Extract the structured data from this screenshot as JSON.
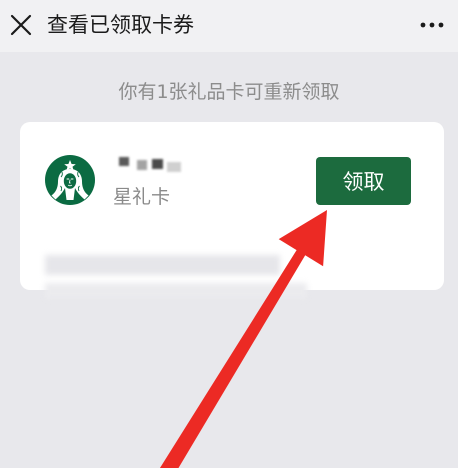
{
  "header": {
    "title": "查看已领取卡券",
    "close_icon": "close-icon",
    "more_icon": "more-icon"
  },
  "notice": "你有1张礼品卡可重新领取",
  "card": {
    "logo_icon": "starbucks-siren-logo",
    "card_name": "星礼卡",
    "claim_button": "领取"
  },
  "colors": {
    "header_bg": "#f1f1f3",
    "page_bg": "#e8e8ec",
    "card_bg": "#ffffff",
    "brand_green": "#1c6b3e",
    "notice_text": "#8c8c8c",
    "annotation_red": "#ec2a24"
  }
}
